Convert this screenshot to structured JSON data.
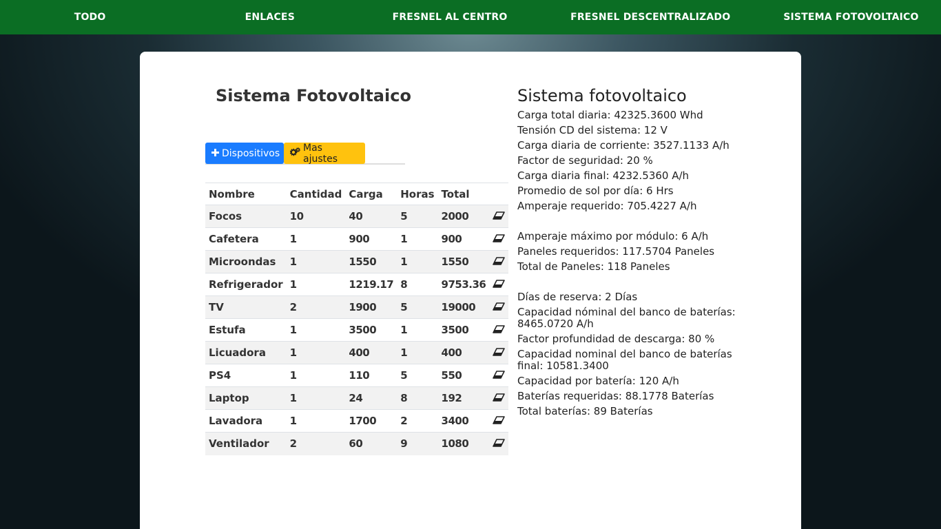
{
  "nav": {
    "items": [
      "TODO",
      "ENLACES",
      "FRESNEL AL CENTRO",
      "FRESNEL DESCENTRALIZADO",
      "SISTEMA FOTOVOLTAICO"
    ]
  },
  "page": {
    "title": "Sistema Fotovoltaico",
    "buttons": {
      "devices_label": "Dispositivos",
      "devices_icon": "plus-icon",
      "settings_label": "Mas ajustes",
      "settings_icon": "gears-icon"
    }
  },
  "table": {
    "headers": [
      "Nombre",
      "Cantidad",
      "Carga",
      "Horas",
      "Total"
    ],
    "rows": [
      {
        "nombre": "Focos",
        "cantidad": "10",
        "carga": "40",
        "horas": "5",
        "total": "2000"
      },
      {
        "nombre": "Cafetera",
        "cantidad": "1",
        "carga": "900",
        "horas": "1",
        "total": "900"
      },
      {
        "nombre": "Microondas",
        "cantidad": "1",
        "carga": "1550",
        "horas": "1",
        "total": "1550"
      },
      {
        "nombre": "Refrigerador",
        "cantidad": "1",
        "carga": "1219.17",
        "horas": "8",
        "total": "9753.36"
      },
      {
        "nombre": "TV",
        "cantidad": "2",
        "carga": "1900",
        "horas": "5",
        "total": "19000"
      },
      {
        "nombre": "Estufa",
        "cantidad": "1",
        "carga": "3500",
        "horas": "1",
        "total": "3500"
      },
      {
        "nombre": "Licuadora",
        "cantidad": "1",
        "carga": "400",
        "horas": "1",
        "total": "400"
      },
      {
        "nombre": "PS4",
        "cantidad": "1",
        "carga": "110",
        "horas": "5",
        "total": "550"
      },
      {
        "nombre": "Laptop",
        "cantidad": "1",
        "carga": "24",
        "horas": "8",
        "total": "192"
      },
      {
        "nombre": "Lavadora",
        "cantidad": "1",
        "carga": "1700",
        "horas": "2",
        "total": "3400"
      },
      {
        "nombre": "Ventilador",
        "cantidad": "2",
        "carga": "60",
        "horas": "9",
        "total": "1080"
      }
    ],
    "row_action_icon": "eraser-icon"
  },
  "summary": {
    "title": "Sistema fotovoltaico",
    "group1": [
      "Carga total diaria: 42325.3600 Whd",
      "Tensión CD del sistema: 12 V",
      "Carga diaria de corriente: 3527.1133 A/h",
      "Factor de seguridad: 20 %",
      "Carga diaria final: 4232.5360 A/h",
      "Promedio de sol por día: 6 Hrs",
      "Amperaje requerido: 705.4227 A/h"
    ],
    "group2": [
      "Amperaje máximo por módulo: 6 A/h",
      "Paneles requeridos: 117.5704 Paneles",
      "Total de Paneles: 118 Paneles"
    ],
    "group3": [
      "Días de reserva: 2 Días",
      "Capacidad nóminal del banco de baterías: 8465.0720 A/h",
      "Factor profundidad de descarga: 80 %",
      "Capacidad nominal del banco de baterías final: 10581.3400",
      "Capacidad por batería: 120 A/h",
      "Baterías requeridas: 88.1778 Baterías",
      "Total baterías: 89 Baterías"
    ]
  },
  "colors": {
    "navbar": "#0b6e24",
    "primary_button": "#1a7cff",
    "warning_button": "#ffc20e"
  }
}
